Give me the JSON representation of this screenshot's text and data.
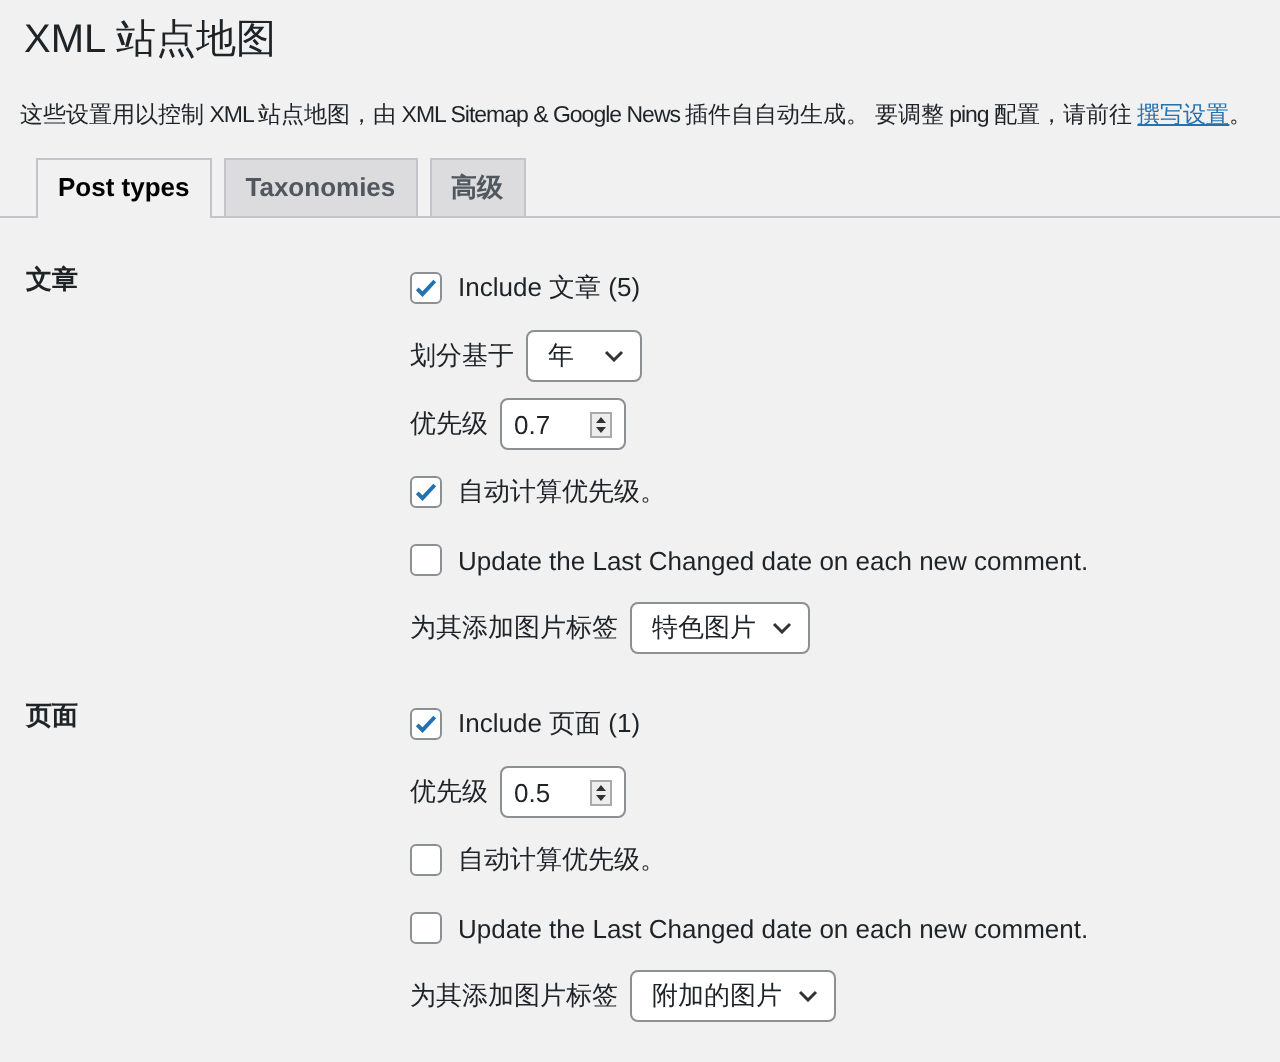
{
  "page": {
    "title": "XML 站点地图",
    "description": "这些设置用以控制 XML 站点地图，由 XML Sitemap & Google News 插件自自动生成。 要调整 ping 配置，请前往 ",
    "description_link": "撰写设置",
    "description_end": "。"
  },
  "tabs": [
    {
      "label": "Post types",
      "selected": true
    },
    {
      "label": "Taxonomies",
      "selected": false
    },
    {
      "label": "高级",
      "selected": false
    }
  ],
  "sections": [
    {
      "heading": "文章",
      "rows": [
        {
          "kind": "checkbox",
          "label": "Include 文章 (5)",
          "checked": true
        },
        {
          "kind": "select",
          "label": "划分基于",
          "value": "年"
        },
        {
          "kind": "number",
          "label": "优先级",
          "value": "0.7"
        },
        {
          "kind": "checkbox",
          "label": "自动计算优先级。",
          "checked": true
        },
        {
          "kind": "checkbox",
          "label": "Update the Last Changed date on each new comment.",
          "checked": false
        },
        {
          "kind": "select",
          "label": "为其添加图片标签",
          "value": "特色图片"
        }
      ]
    },
    {
      "heading": "页面",
      "rows": [
        {
          "kind": "checkbox",
          "label": "Include 页面 (1)",
          "checked": true
        },
        {
          "kind": "number",
          "label": "优先级",
          "value": "0.5"
        },
        {
          "kind": "checkbox",
          "label": "自动计算优先级。",
          "checked": false
        },
        {
          "kind": "checkbox",
          "label": "Update the Last Changed date on each new comment.",
          "checked": false
        },
        {
          "kind": "select",
          "label": "为其添加图片标签",
          "value": "附加的图片"
        }
      ]
    }
  ]
}
